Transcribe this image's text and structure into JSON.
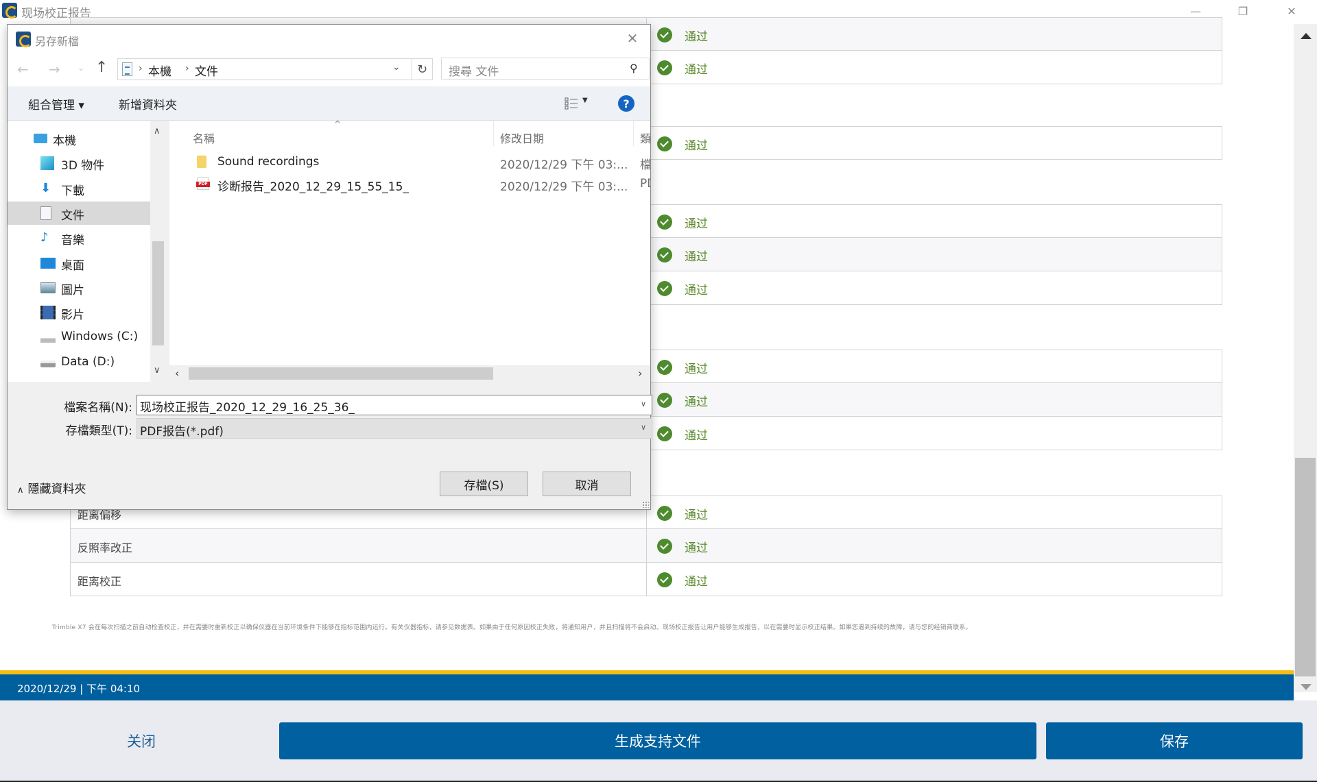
{
  "app": {
    "title": "现场校正报告",
    "window_controls": {
      "minimize": "—",
      "restore": "❐",
      "close": "✕"
    }
  },
  "report": {
    "groups": [
      {
        "rows": [
          {
            "label": "",
            "result": "通过",
            "alt": true
          },
          {
            "label": "",
            "result": "通过",
            "alt": false
          }
        ]
      },
      {
        "rows": [
          {
            "label": "",
            "result": "通过",
            "alt": false
          }
        ]
      },
      {
        "rows": [
          {
            "label": "",
            "result": "通过",
            "alt": false
          },
          {
            "label": "",
            "result": "通过",
            "alt": true
          },
          {
            "label": "",
            "result": "通过",
            "alt": false
          }
        ]
      },
      {
        "rows": [
          {
            "label": "",
            "result": "通过",
            "alt": false
          },
          {
            "label": "",
            "result": "通过",
            "alt": true
          },
          {
            "label": "",
            "result": "通过",
            "alt": false
          }
        ]
      },
      {
        "rows": [
          {
            "label": "距离偏移",
            "result": "通过",
            "alt": false
          },
          {
            "label": "反照率改正",
            "result": "通过",
            "alt": true
          },
          {
            "label": "距离校正",
            "result": "通过",
            "alt": false
          }
        ]
      }
    ],
    "note": "Trimble X7 会在每次扫描之前自动检查校正，并在需要时重新校正以确保仪器在当前环境条件下能够在指标范围内运行。有关仪器指标，请参见数据表。如果由于任何原因校正失败，将通知用户，并且扫描将不会启动。现场校正报告让用户能够生成报告，以在需要时显示校正结果。如果您遇到持续的故障，请与您的经销商联系。"
  },
  "status_bar": {
    "datetime": "2020/12/29 | 下午 04:10"
  },
  "actions": {
    "close": "关闭",
    "generate": "生成支持文件",
    "save": "保存"
  },
  "colors": {
    "brand_blue": "#0060a0",
    "accent_yellow": "#f6bd14",
    "pass_green": "#4e8a2e"
  },
  "dialog": {
    "title": "另存新檔",
    "close_icon": "✕",
    "nav": {
      "back": "←",
      "forward": "→",
      "recent": "⌄",
      "up": "↑"
    },
    "breadcrumb": [
      "本機",
      "文件"
    ],
    "refresh_icon": "↻",
    "search_placeholder": "搜尋 文件",
    "organize": "組合管理 ▾",
    "new_folder": "新增資料夾",
    "help": "?",
    "nav_pane": [
      {
        "label": "本機",
        "icon": "computer-icon",
        "selected": false
      },
      {
        "label": "3D 物件",
        "icon": "3d-objects-icon",
        "selected": false
      },
      {
        "label": "下載",
        "icon": "download-icon",
        "selected": false
      },
      {
        "label": "文件",
        "icon": "documents-icon",
        "selected": true
      },
      {
        "label": "音樂",
        "icon": "music-icon",
        "selected": false
      },
      {
        "label": "桌面",
        "icon": "desktop-icon",
        "selected": false
      },
      {
        "label": "圖片",
        "icon": "pictures-icon",
        "selected": false
      },
      {
        "label": "影片",
        "icon": "videos-icon",
        "selected": false
      },
      {
        "label": "Windows (C:)",
        "icon": "windows-drive-icon",
        "selected": false
      },
      {
        "label": "Data (D:)",
        "icon": "drive-icon",
        "selected": false
      }
    ],
    "columns": {
      "name": "名稱",
      "modified": "修改日期",
      "type": "類型"
    },
    "files": [
      {
        "name": "Sound recordings",
        "modified": "2020/12/29 下午 03:...",
        "type": "檔案",
        "icon": "folder-icon"
      },
      {
        "name": "诊断报告_2020_12_29_15_55_15_",
        "modified": "2020/12/29 下午 03:...",
        "type": "PDF",
        "icon": "pdf-icon"
      }
    ],
    "file_name_label": "檔案名稱(N):",
    "file_name_value": "现场校正报告_2020_12_29_16_25_36_",
    "file_type_label": "存檔類型(T):",
    "file_type_value": "PDF报告(*.pdf)",
    "hide_folders": "隱藏資料夾",
    "save_button": "存檔(S)",
    "cancel_button": "取消"
  }
}
